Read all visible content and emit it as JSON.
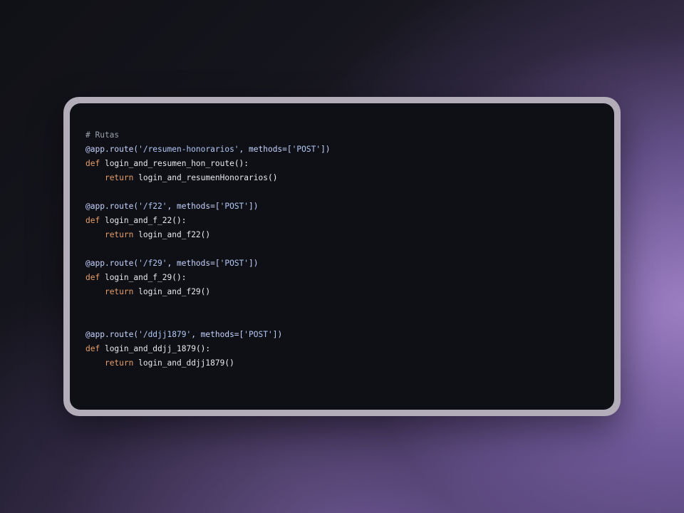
{
  "code": {
    "comment": "# Rutas",
    "blocks": [
      {
        "decorator": "@app.route(",
        "path": "'/resumen-honorarios'",
        "methods_kw": ", methods=[",
        "method": "'POST'",
        "close": "])",
        "def_kw": "def",
        "func_name": " login_and_resumen_hon_route",
        "func_sig": "():",
        "return_kw": "return",
        "return_call": " login_and_resumenHonorarios",
        "return_paren": "()"
      },
      {
        "decorator": "@app.route(",
        "path": "'/f22'",
        "methods_kw": ", methods=[",
        "method": "'POST'",
        "close": "])",
        "def_kw": "def",
        "func_name": " login_and_f_22",
        "func_sig": "():",
        "return_kw": "return",
        "return_call": " login_and_f22",
        "return_paren": "()"
      },
      {
        "decorator": "@app.route(",
        "path": "'/f29'",
        "methods_kw": ", methods=[",
        "method": "'POST'",
        "close": "])",
        "def_kw": "def",
        "func_name": " login_and_f_29",
        "func_sig": "():",
        "return_kw": "return",
        "return_call": " login_and_f29",
        "return_paren": "()"
      },
      {
        "decorator": "@app.route(",
        "path": "'/ddjj1879'",
        "methods_kw": ", methods=[",
        "method": "'POST'",
        "close": "])",
        "def_kw": "def",
        "func_name": " login_and_ddjj_1879",
        "func_sig": "():",
        "return_kw": "return",
        "return_call": " login_and_ddjj1879",
        "return_paren": "()"
      }
    ]
  },
  "colors": {
    "panel_background": "#0e1015",
    "frame": "#b2adb8",
    "keyword": "#e89e6c",
    "decorator": "#c8d3ff",
    "comment": "#9ba0aa"
  }
}
